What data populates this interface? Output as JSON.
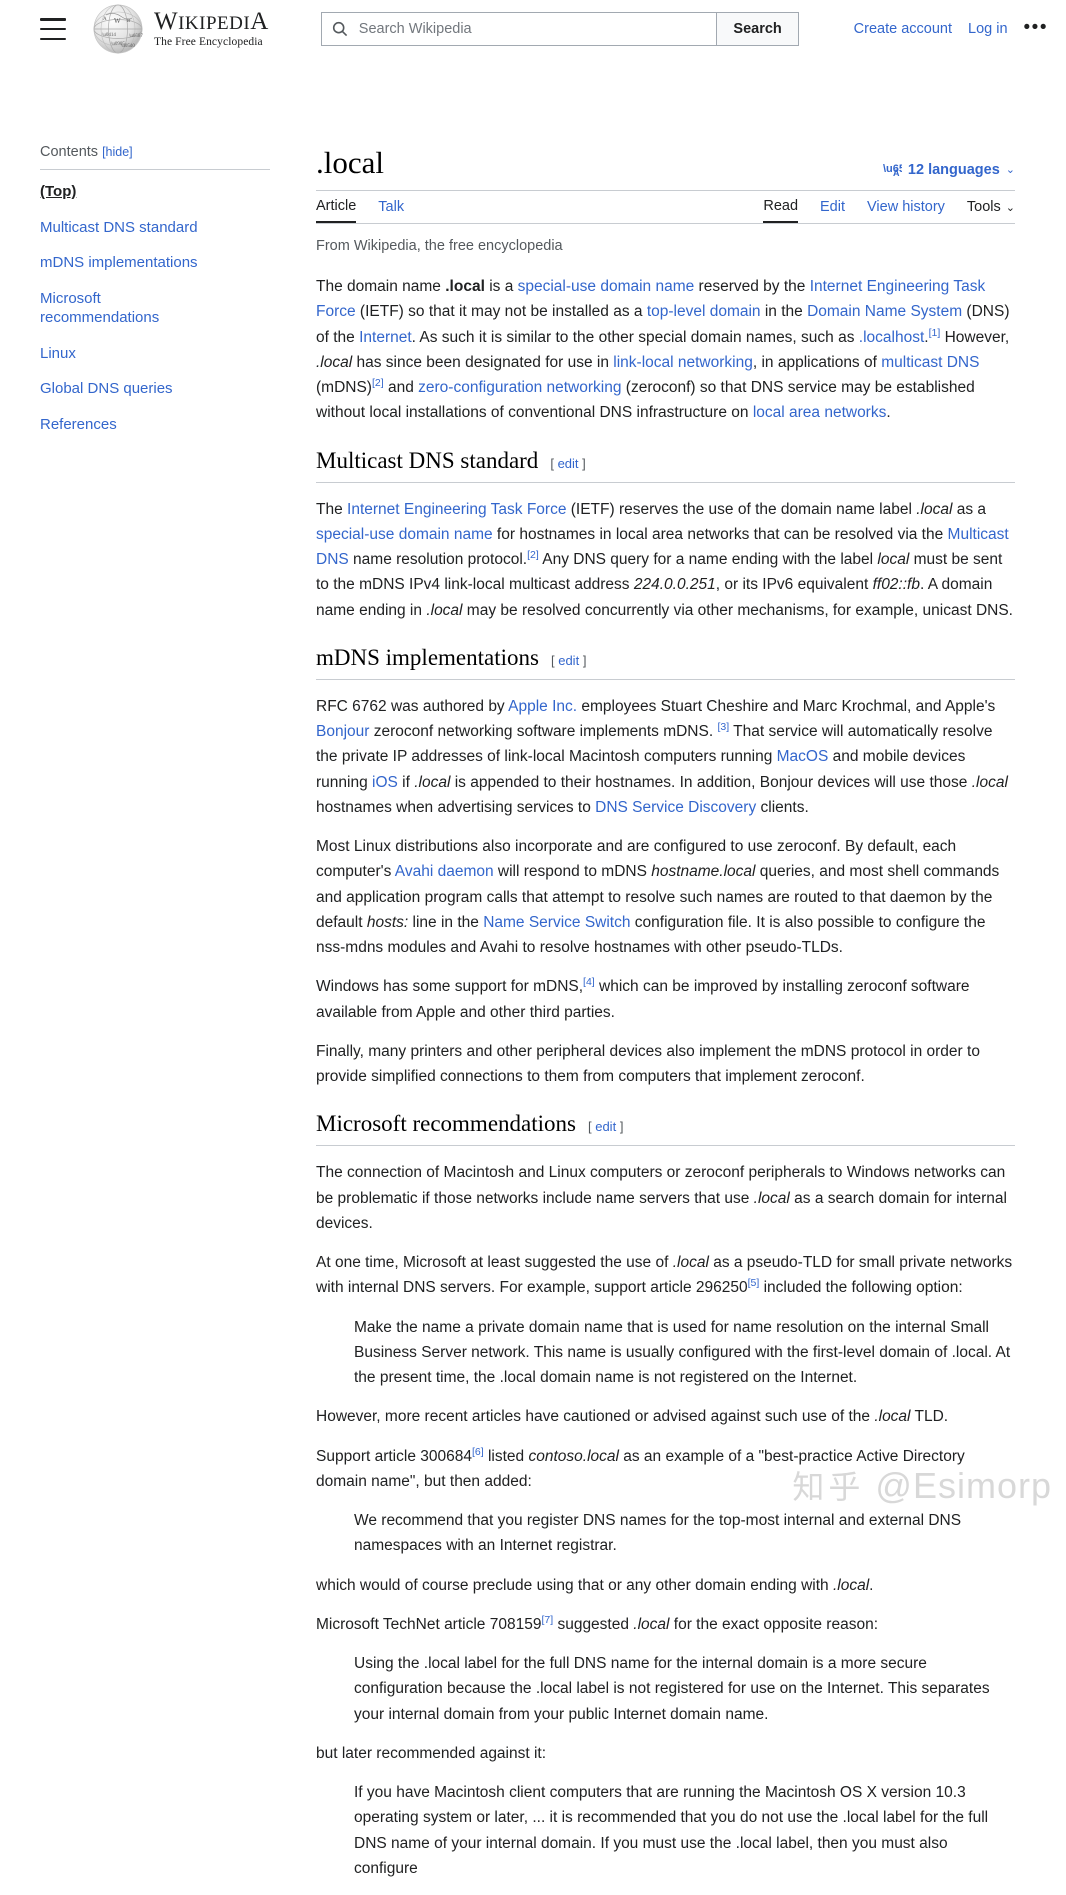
{
  "header": {
    "menu_icon": "hamburger-icon",
    "logo": {
      "wordmark_w": "W",
      "wordmark_rest": "IKIPEDI",
      "wordmark_a": "A",
      "tagline": "The Free Encyclopedia"
    },
    "search": {
      "placeholder": "Search Wikipedia",
      "value": "",
      "button_label": "Search",
      "icon": "search-icon"
    },
    "create_account": "Create account",
    "log_in": "Log in",
    "more_label": "•••"
  },
  "toc": {
    "heading": "Contents",
    "hide_label": "[hide]",
    "items": [
      {
        "label": "(Top)",
        "active": true
      },
      {
        "label": "Multicast DNS standard",
        "active": false
      },
      {
        "label": "mDNS implementations",
        "active": false
      },
      {
        "label": "Microsoft recommendations",
        "active": false
      },
      {
        "label": "Linux",
        "active": false
      },
      {
        "label": "Global DNS queries",
        "active": false
      },
      {
        "label": "References",
        "active": false
      }
    ]
  },
  "article": {
    "title": ".local",
    "languages_label": "12 languages",
    "languages_icon": "translate-icon",
    "languages_caret": "⌄",
    "tabs_left": [
      {
        "label": "Article",
        "active": true
      },
      {
        "label": "Talk",
        "active": false
      }
    ],
    "tabs_right": [
      {
        "label": "Read",
        "active": true
      },
      {
        "label": "Edit",
        "active": false
      },
      {
        "label": "View history",
        "active": false
      }
    ],
    "tools_label": "Tools",
    "tools_caret": "⌄",
    "site_sub": "From Wikipedia, the free encyclopedia",
    "edit_label": "edit",
    "edit_open": "[",
    "edit_close": "]"
  },
  "lead": {
    "p1": {
      "t1": "The domain name ",
      "b1": ".local",
      "t2": " is a ",
      "l1": "special-use domain name",
      "t3": " reserved by the ",
      "l2": "Internet Engineering Task Force",
      "t4": " (IETF) so that it may not be installed as a ",
      "l3": "top-level domain",
      "t5": " in the ",
      "l4": "Domain Name System",
      "t6": " (DNS) of the ",
      "l5": "Internet",
      "t7": ". As such it is similar to the other special domain names, such as ",
      "l6": ".localhost",
      "t8": ".",
      "r1": "[1]",
      "t9": " However, ",
      "i1": ".local",
      "t10": " has since been designated for use in ",
      "l7": "link-local networking",
      "t11": ", in applications of ",
      "l8": "multicast DNS",
      "t12": " (mDNS)",
      "r2": "[2]",
      "t13": " and ",
      "l9": "zero-configuration networking",
      "t14": " (zeroconf) so that DNS service may be established without local installations of conventional DNS infrastructure on ",
      "l10": "local area networks",
      "t15": "."
    }
  },
  "sections": [
    {
      "id": "multicast-dns-standard",
      "heading": "Multicast DNS standard",
      "p1": {
        "t1": "The ",
        "l1": "Internet Engineering Task Force",
        "t2": " (IETF) reserves the use of the domain name label ",
        "i1": ".local",
        "t3": " as a ",
        "l2": "special-use domain name",
        "t4": " for hostnames in local area networks that can be resolved via the ",
        "l3": "Multicast DNS",
        "t5": " name resolution protocol.",
        "r1": "[2]",
        "t6": " Any DNS query for a name ending with the label ",
        "i2": "local",
        "t7": " must be sent to the mDNS IPv4 link-local multicast address ",
        "i3": "224.0.0.251",
        "t8": ", or its IPv6 equivalent ",
        "i4": "ff02::fb",
        "t9": ". A domain name ending in ",
        "i5": ".local",
        "t10": " may be resolved concurrently via other mechanisms, for example, unicast DNS."
      }
    },
    {
      "id": "mdns-implementations",
      "heading": "mDNS implementations",
      "p1": {
        "t1": "RFC 6762 was authored by ",
        "l1": "Apple Inc.",
        "t2": " employees Stuart Cheshire and Marc Krochmal, and Apple's ",
        "l2": "Bonjour",
        "t3": " zeroconf networking software implements mDNS. ",
        "r1": "[3]",
        "t4": " That service will automatically resolve the private IP addresses of link-local Macintosh computers running ",
        "l3": "MacOS",
        "t5": " and mobile devices running ",
        "l4": "iOS",
        "t6": " if ",
        "i1": ".local",
        "t7": " is appended to their hostnames. In addition, Bonjour devices will use those ",
        "i2": ".local",
        "t8": " hostnames when advertising services to ",
        "l5": "DNS Service Discovery",
        "t9": " clients."
      },
      "p2": {
        "t1": "Most Linux distributions also incorporate and are configured to use zeroconf. By default, each computer's ",
        "l1": "Avahi daemon",
        "t2": " will respond to mDNS ",
        "i1": "hostname.local",
        "t3": " queries, and most shell commands and application program calls that attempt to resolve such names are routed to that daemon by the default ",
        "i2": "hosts:",
        "t4": " line in the ",
        "l2": "Name Service Switch",
        "t5": " configuration file. It is also possible to configure the nss-mdns modules and Avahi to resolve hostnames with other pseudo-TLDs."
      },
      "p3": {
        "t1": "Windows has some support for mDNS,",
        "r1": "[4]",
        "t2": " which can be improved by installing zeroconf software available from Apple and other third parties."
      },
      "p4": {
        "t1": "Finally, many printers and other peripheral devices also implement the mDNS protocol in order to provide simplified connections to them from computers that implement zeroconf."
      }
    },
    {
      "id": "microsoft-recommendations",
      "heading": "Microsoft recommendations",
      "p1": {
        "t1": "The connection of Macintosh and Linux computers or zeroconf peripherals to Windows networks can be problematic if those networks include name servers that use ",
        "i1": ".local",
        "t2": " as a search domain for internal devices."
      },
      "p2": {
        "t1": "At one time, Microsoft at least suggested the use of ",
        "i1": ".local",
        "t2": " as a pseudo-TLD for small private networks with internal DNS servers. For example, support article 296250",
        "r1": "[5]",
        "t3": " included the following option:"
      },
      "q1": "Make the name a private domain name that is used for name resolution on the internal Small Business Server network. This name is usually configured with the first-level domain of .local. At the present time, the .local domain name is not registered on the Internet.",
      "p3": {
        "t1": "However, more recent articles have cautioned or advised against such use of the ",
        "i1": ".local",
        "t2": " TLD."
      },
      "p4": {
        "t1": "Support article 300684",
        "r1": "[6]",
        "t2": " listed ",
        "i1": "contoso.local",
        "t3": " as an example of a \"best-practice Active Directory domain name\", but then added:"
      },
      "q2": "We recommend that you register DNS names for the top-most internal and external DNS namespaces with an Internet registrar.",
      "p5": {
        "t1": "which would of course preclude using that or any other domain ending with ",
        "i1": ".local",
        "t2": "."
      },
      "p6": {
        "t1": "Microsoft TechNet article 708159",
        "r1": "[7]",
        "t2": " suggested ",
        "i1": ".local",
        "t3": " for the exact opposite reason:"
      },
      "q3": "Using the .local label for the full DNS name for the internal domain is a more secure configuration because the .local label is not registered for use on the Internet. This separates your internal domain from your public Internet domain name.",
      "p7": {
        "t1": "but later recommended against it:"
      },
      "q4": "If you have Macintosh client computers that are running the Macintosh OS X version 10.3 operating system or later, ... it is recommended that you do not use the .local label for the full DNS name of your internal domain. If you must use the .local label, then you must also configure"
    }
  ],
  "watermark": {
    "zh": "知乎",
    "handle": "@Esimorp"
  },
  "colors": {
    "link": "#3366cc",
    "text": "#202122",
    "muted": "#54595d",
    "rule": "#c8ccd1",
    "border": "#a2a9b1",
    "button_bg": "#f8f9fa",
    "watermark": "#d8d8d8"
  }
}
